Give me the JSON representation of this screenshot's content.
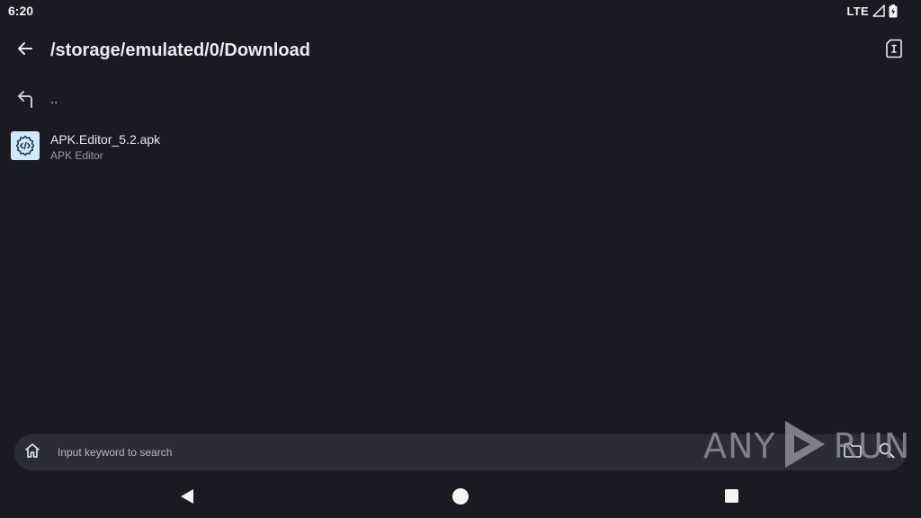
{
  "status_bar": {
    "time": "6:20",
    "network": "LTE",
    "icons": [
      "signal-icon",
      "battery-icon"
    ]
  },
  "app_bar": {
    "path": "/storage/emulated/0/Download",
    "back_icon": "arrow-left-icon",
    "action_icon": "sd-card-icon"
  },
  "file_list": {
    "parent": {
      "label": "..",
      "icon": "arrow-up-left-icon"
    },
    "items": [
      {
        "name": "APK.Editor_5.2.apk",
        "subtitle": "APK Editor",
        "icon": "apk-gear-code-icon"
      }
    ]
  },
  "search_bar": {
    "placeholder": "Input keyword to search",
    "home_icon": "home-icon",
    "folder_icon": "folder-icon",
    "search_icon": "search-icon"
  },
  "watermark": {
    "left": "ANY",
    "right": "RUN"
  },
  "colors": {
    "background": "#1a1b22",
    "search_bg": "#2b2c34",
    "apk_icon_bg": "#cfe8fb",
    "text_primary": "#e9eaf0",
    "text_secondary": "#9a9ba6"
  }
}
